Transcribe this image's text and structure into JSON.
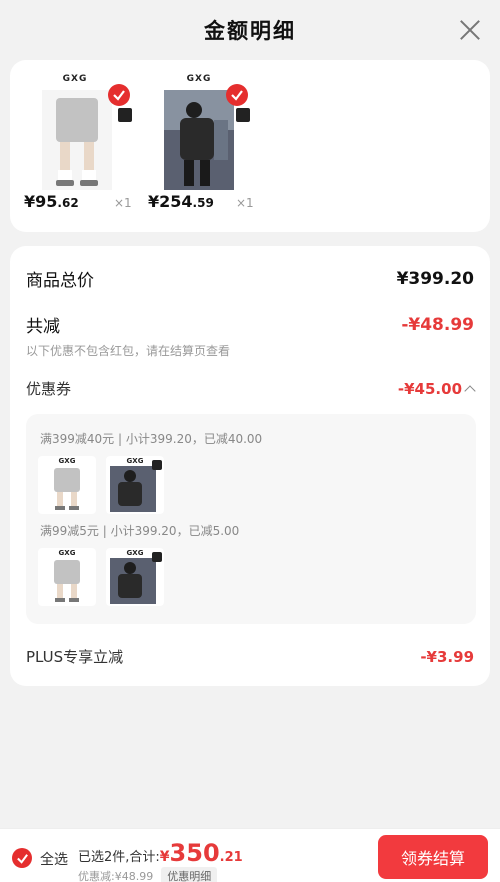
{
  "header": {
    "title": "金额明细"
  },
  "products": [
    {
      "brand": "GXG",
      "price_int": "¥95",
      "price_dec": ".62",
      "qty": "×1",
      "color": "#bdbdbd"
    },
    {
      "brand": "GXG",
      "price_int": "¥254",
      "price_dec": ".59",
      "qty": "×1",
      "color": "#2c2c2c"
    }
  ],
  "summary": {
    "total_label": "商品总价",
    "total_value": "¥399.20",
    "reduce_label": "共减",
    "reduce_value": "-¥48.99",
    "reduce_note": "以下优惠不包含红包，请在结算页查看",
    "coupon_label": "优惠券",
    "coupon_value": "-¥45.00",
    "coupons": [
      {
        "title": "满399减40元 | 小计399.20，已减40.00"
      },
      {
        "title": "满99减5元 | 小计399.20，已减5.00"
      }
    ],
    "plus_label": "PLUS专享立减",
    "plus_value": "-¥3.99"
  },
  "bottom": {
    "select_all": "全选",
    "selected_text": "已选2件,合计:",
    "total_sym": "¥",
    "total_int": "350",
    "total_dec": ".21",
    "discount_text": "优惠减:¥48.99",
    "detail_chip": "优惠明细",
    "checkout": "领券结算"
  },
  "colors": {
    "accent": "#e63a3a",
    "button": "#f23a3e",
    "background": "#f2f2f2"
  }
}
